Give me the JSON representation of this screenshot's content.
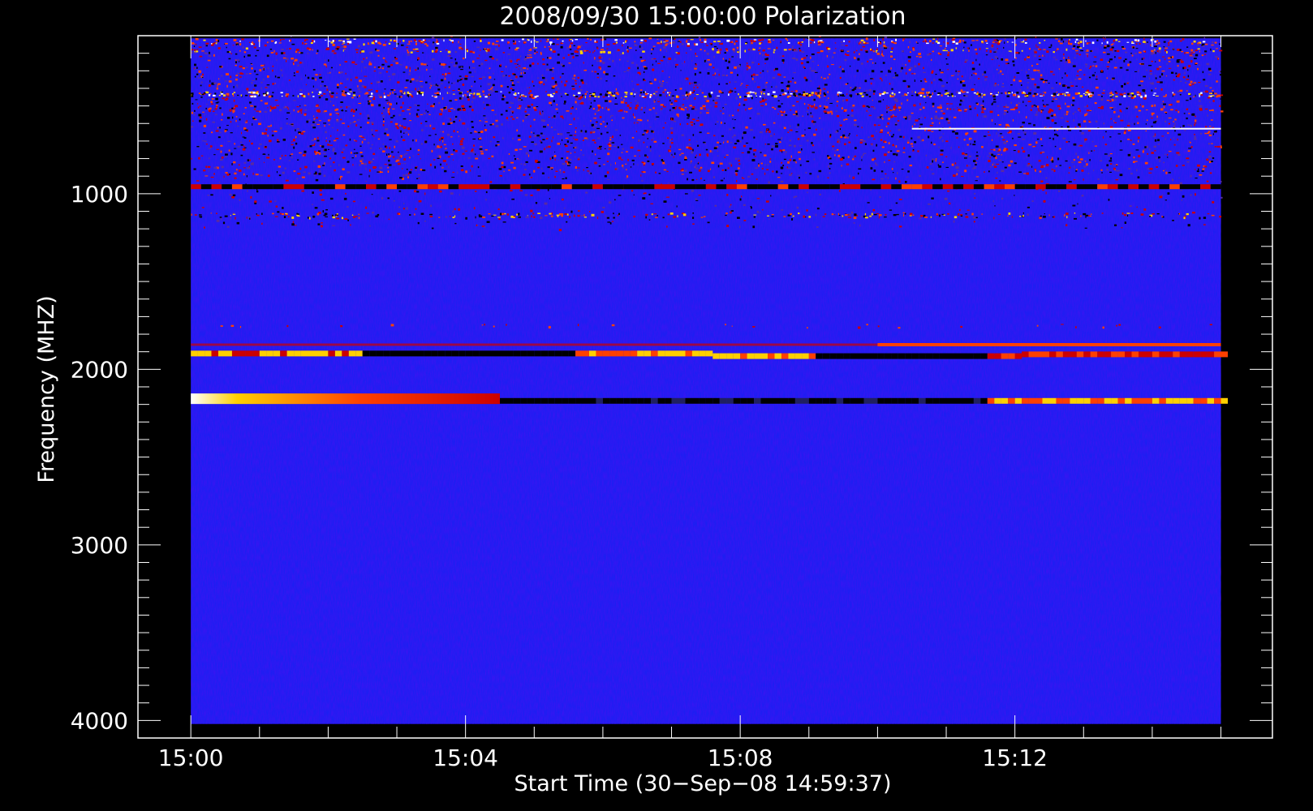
{
  "chart_data": {
    "type": "heatmap",
    "title": "2008/09/30 15:00:00 Polarization",
    "xlabel": "Start Time (30−Sep−08 14:59:37)",
    "ylabel": "Frequency (MHZ)",
    "x_ticks": [
      "15:00",
      "15:04",
      "15:08",
      "15:12"
    ],
    "x_tick_minutes": [
      0,
      4,
      8,
      12
    ],
    "x_range_minutes": [
      -0.77,
      15.75
    ],
    "x_data_range_minutes": [
      0,
      15
    ],
    "y_ticks": [
      1000,
      2000,
      3000,
      4000
    ],
    "y_range": [
      100,
      4100
    ],
    "y_data_range": [
      115,
      4020
    ],
    "y_inverted": true,
    "grid": false,
    "colormap": [
      "#000000",
      "#0000ff",
      "#cc0000",
      "#ff4000",
      "#ffd000",
      "#ffffff"
    ],
    "background_color": "#1e1ef2",
    "features": [
      {
        "freq": 2170,
        "t_start": 0,
        "t_end": 4.5,
        "level": "very high"
      },
      {
        "freq": 2185,
        "t_start": 4.5,
        "t_end": 15,
        "level": "mixed"
      },
      {
        "freq": 1910,
        "t_start": 0,
        "t_end": 15,
        "level": "mixed"
      },
      {
        "freq": 1860,
        "t_start": 10,
        "t_end": 15,
        "level": "high"
      },
      {
        "freq": 960,
        "t_start": 0,
        "t_end": 15,
        "level": "mixed"
      },
      {
        "freq": 430,
        "t_start": 0,
        "t_end": 15,
        "level": "high"
      },
      {
        "freq": 630,
        "t_start": 10.5,
        "t_end": 15,
        "level": "high"
      }
    ]
  }
}
